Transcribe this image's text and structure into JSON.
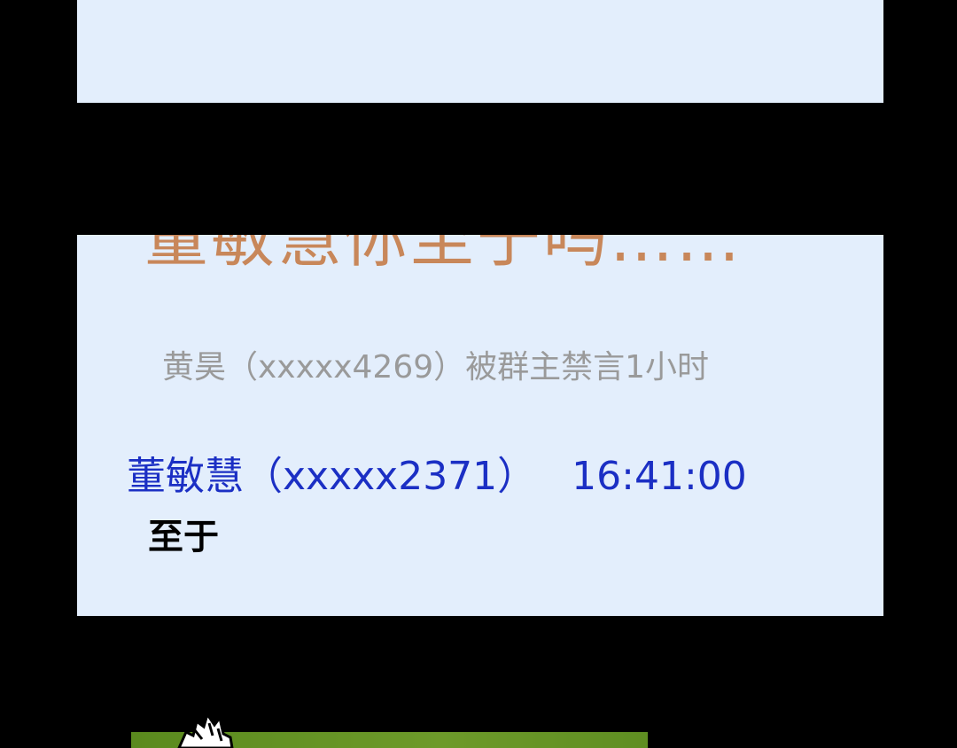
{
  "panel_main": {
    "cut_off_text": "董敏慧你至于吗……",
    "system_notice": "黄昊（xxxxx4269）被群主禁言1小时",
    "sender": "董敏慧（xxxxx2371）",
    "time": "16:41:00",
    "message": "至于"
  },
  "colors": {
    "background": "#000000",
    "panel": "#e3eefc",
    "cut_off_text": "#c8875a",
    "system_notice": "#9a9a9a",
    "sender": "#1b2fc4",
    "message": "#000000",
    "next_panel": "#5a8a1e"
  }
}
